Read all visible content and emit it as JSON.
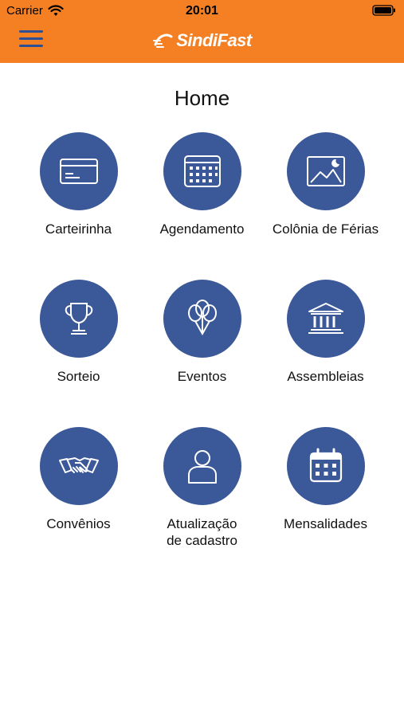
{
  "status_bar": {
    "carrier": "Carrier",
    "time": "20:01"
  },
  "header": {
    "brand": "SindiFast",
    "brand_color": "#f58024"
  },
  "page": {
    "title": "Home"
  },
  "tiles": [
    {
      "label": "Carteirinha",
      "icon": "id-card-icon"
    },
    {
      "label": "Agendamento",
      "icon": "calendar-grid-icon"
    },
    {
      "label": "Colônia de Férias",
      "icon": "landscape-photo-icon"
    },
    {
      "label": "Sorteio",
      "icon": "trophy-icon"
    },
    {
      "label": "Eventos",
      "icon": "balloons-icon"
    },
    {
      "label": "Assembleias",
      "icon": "columns-building-icon"
    },
    {
      "label": "Convênios",
      "icon": "handshake-icon"
    },
    {
      "label": "Atualização\nde cadastro",
      "icon": "user-profile-icon"
    },
    {
      "label": "Mensalidades",
      "icon": "calendar-dots-icon"
    }
  ],
  "colors": {
    "icon_circle": "#3b5898",
    "menu_icon": "#2d4f95"
  }
}
